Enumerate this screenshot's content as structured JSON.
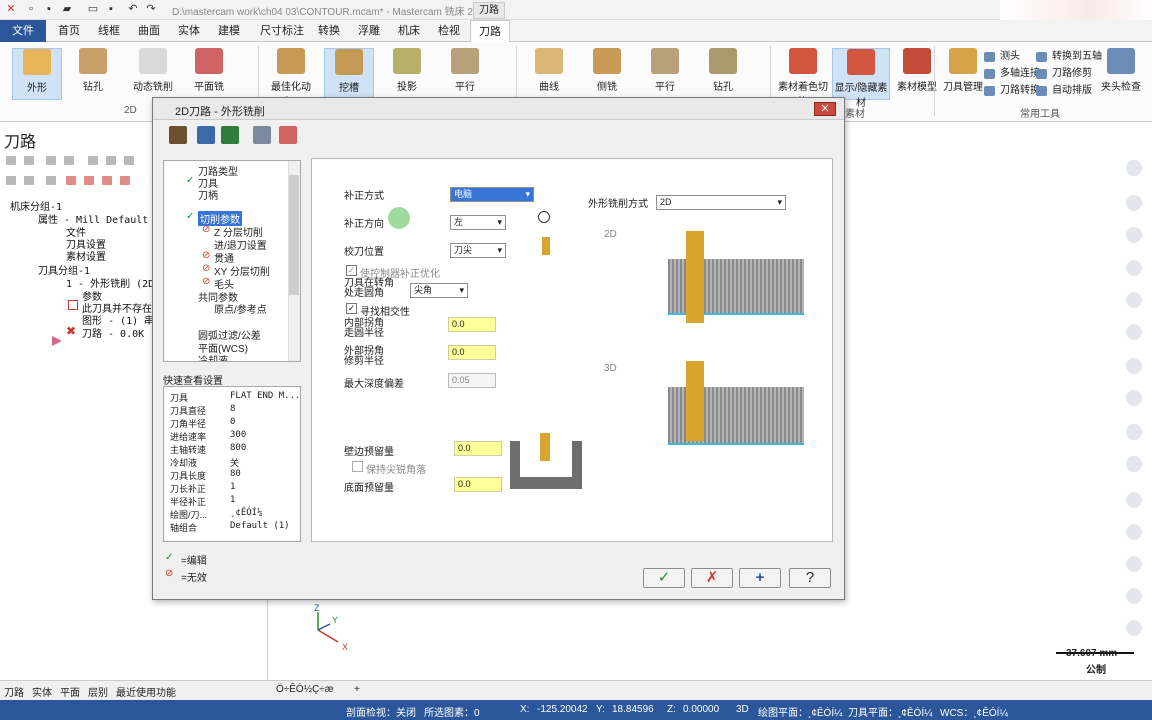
{
  "window": {
    "title": "D:\\mastercam work\\ch04 03\\CONTOUR.mcam* - Mastercam 铣床 2019",
    "context_label": "刀路"
  },
  "menu_tabs": [
    "文件",
    "首页",
    "线框",
    "曲面",
    "实体",
    "建模",
    "尺寸标注",
    "转换",
    "浮雕",
    "机床",
    "检视",
    "刀路"
  ],
  "ribbon": {
    "buttons_2d": [
      "外形",
      "钻孔",
      "动态铣削",
      "平面铣"
    ],
    "group_2d": "2D",
    "buttons_3d": [
      "最佳化动态...",
      "挖槽",
      "投影",
      "平行"
    ],
    "buttons_multi": [
      "曲线",
      "侧铣",
      "平行",
      "钻孔"
    ],
    "buttons_stock": [
      "素材着色切换",
      "显示/隐藏素材",
      "素材模型"
    ],
    "group_stock": "素材",
    "tool_mgr": "刀具管理",
    "small_tools": [
      "测头",
      "多轴连接",
      "刀路转换",
      "转换到五轴",
      "刀路修剪",
      "自动排版"
    ],
    "holder": "夹头检查",
    "group_tools": "常用工具"
  },
  "left_panel": {
    "title": "刀路",
    "tree": [
      "机床分组-1",
      "属性 - Mill Default",
      "文件",
      "刀具设置",
      "素材设置",
      "刀具分组-1",
      "1 - 外形铣削 (2D)",
      "参数",
      "此刀具并不存在",
      "图形 - (1) 串连",
      "刀路 - 0.0K - C"
    ]
  },
  "dialog": {
    "title": "2D刀路 - 外形铣削",
    "close": "✕",
    "tree": [
      "刀路类型",
      "刀具",
      "刀柄",
      "切削参数",
      "Z 分层切削",
      "进/退刀设置",
      "贯通",
      "XY 分层切削",
      "毛头",
      "共同参数",
      "原点/参考点",
      "圆弧过滤/公差",
      "平面(WCS)",
      "冷却液"
    ],
    "quick_title": "快速查看设置",
    "quick": [
      {
        "k": "刀具",
        "v": "FLAT END M..."
      },
      {
        "k": "刀具直径",
        "v": "8"
      },
      {
        "k": "刀角半径",
        "v": "0"
      },
      {
        "k": "进给速率",
        "v": "300"
      },
      {
        "k": "主轴转速",
        "v": "800"
      },
      {
        "k": "冷却液",
        "v": "关"
      },
      {
        "k": "刀具长度",
        "v": "80"
      },
      {
        "k": "刀长补正",
        "v": "1"
      },
      {
        "k": "半径补正",
        "v": "1"
      },
      {
        "k": "绘图/刀...",
        "v": "¸¢ÊÓÍ¼"
      },
      {
        "k": "轴组合",
        "v": "Default (1)"
      }
    ],
    "legend_edit": "=编辑",
    "legend_invalid": "=无效",
    "fields": {
      "comp_type_label": "补正方式",
      "comp_type": "电脑",
      "comp_dir_label": "补正方向",
      "comp_dir": "左",
      "tip_label": "校刀位置",
      "tip": "刀尖",
      "optimize": "使控制器补正优化",
      "corner_label": "刀具在转角\n处走圆角",
      "corner": "尖角",
      "find_intersect": "寻找相交性",
      "inner_r_label": "内部拐角\n走圆半径",
      "inner_r": "0.0",
      "outer_r_label": "外部拐角\n修剪半径",
      "outer_r": "0.0",
      "max_depth_label": "最大深度偏差",
      "max_depth": "0.05",
      "wall_label": "壁边预留量",
      "wall": "0.0",
      "keep_sharp": "保持尖锐角落",
      "floor_label": "底面预留量",
      "floor": "0.0",
      "mill_type_label": "外形铣削方式",
      "mill_type": "2D",
      "opt_2d": "2D",
      "opt_3d": "3D"
    },
    "buttons": {
      "ok": "✓",
      "cancel": "✗",
      "add": "+",
      "help": "?"
    }
  },
  "bottom_tabs": [
    "刀路",
    "实体",
    "平面",
    "层别",
    "最近使用功能"
  ],
  "viewsheet": "Ö÷ÊÓ½Ç÷æ",
  "scale": {
    "value": "37.607 mm",
    "unit": "公制"
  },
  "status": {
    "section": "剖面检视：关闭",
    "selected": "所选图素：0",
    "x_label": "X:",
    "x": "-125.20042",
    "y_label": "Y:",
    "y": "18.84596",
    "z_label": "Z:",
    "z": "0.00000",
    "mode": "3D",
    "cplane": "绘图平面：¸¢ÊÓÍ¼",
    "tplane": "刀具平面：¸¢ÊÓÍ¼",
    "wcs": "WCS：¸¢ÊÓÍ¼"
  },
  "colors": {
    "accent": "#2b579a",
    "yellow_field": "#ffff99",
    "selected": "#cfe2f6"
  }
}
